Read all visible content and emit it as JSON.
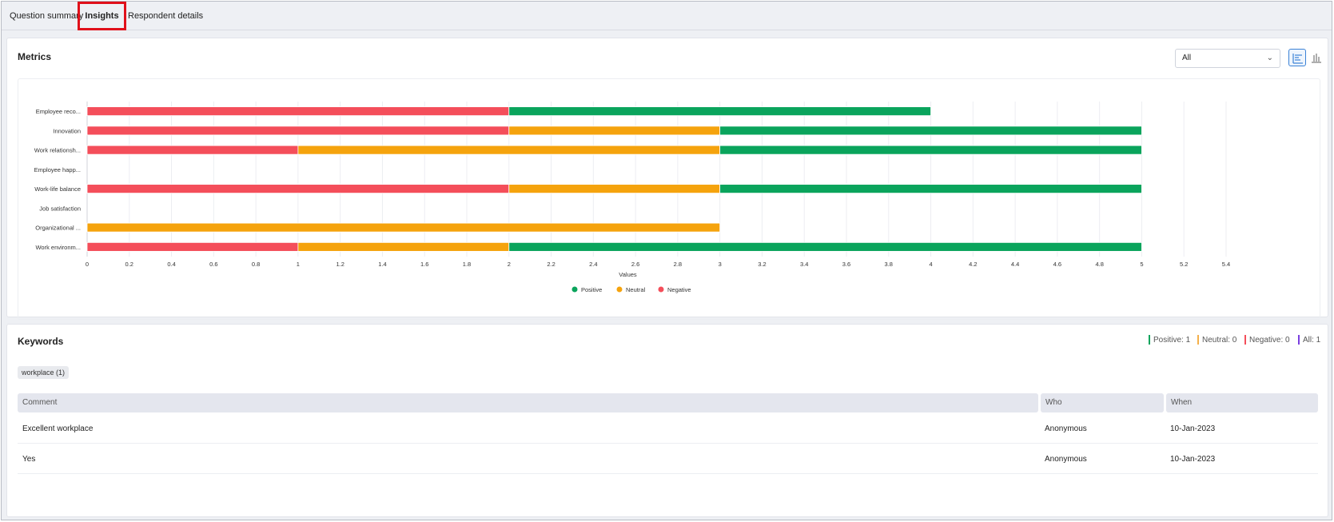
{
  "tabs": [
    {
      "label": "Question summary"
    },
    {
      "label": "Insights"
    },
    {
      "label": "Respondent details"
    }
  ],
  "metrics": {
    "title": "Metrics",
    "filter_value": "All",
    "view_icons": [
      "horizontal-bar-chart-icon",
      "vertical-bar-chart-icon"
    ]
  },
  "chart_data": {
    "type": "bar",
    "orientation": "horizontal",
    "stacked": true,
    "categories": [
      "Employee reco...",
      "Innovation",
      "Work relationsh...",
      "Employee happ...",
      "Work-life balance",
      "Job satisfaction",
      "Organizational ...",
      "Work environm..."
    ],
    "series": [
      {
        "name": "Negative",
        "color": "#f44e5a",
        "values": [
          2,
          2,
          1,
          0,
          2,
          0,
          0,
          1
        ]
      },
      {
        "name": "Neutral",
        "color": "#f5a30d",
        "values": [
          0,
          1,
          2,
          0,
          1,
          0,
          3,
          1
        ]
      },
      {
        "name": "Positive",
        "color": "#0aa45c",
        "values": [
          2,
          2,
          2,
          0,
          2,
          0,
          0,
          3
        ]
      }
    ],
    "legend": [
      "Positive",
      "Neutral",
      "Negative"
    ],
    "legend_colors": [
      "#0aa45c",
      "#f5a30d",
      "#f44e5a"
    ],
    "xlabel": "Values",
    "xlim": [
      0,
      5.4
    ],
    "xticks": [
      "0",
      "0.2",
      "0.4",
      "0.6",
      "0.8",
      "1",
      "1.2",
      "1.4",
      "1.6",
      "1.8",
      "2",
      "2.2",
      "2.4",
      "2.6",
      "2.8",
      "3",
      "3.2",
      "3.4",
      "3.6",
      "3.8",
      "4",
      "4.2",
      "4.4",
      "4.6",
      "4.8",
      "5",
      "5.2",
      "5.4"
    ],
    "grid": true,
    "legend_position": "bottom"
  },
  "keywords": {
    "title": "Keywords",
    "stats": [
      {
        "label": "Positive: 1",
        "color": "#0aa45c"
      },
      {
        "label": "Neutral: 0",
        "color": "#f5b04a"
      },
      {
        "label": "Negative: 0",
        "color": "#f44e5a"
      },
      {
        "label": "All: 1",
        "color": "#7a3fe0"
      }
    ],
    "chip": "workplace (1)",
    "table": {
      "headers": [
        "Comment",
        "Who",
        "When"
      ],
      "rows": [
        [
          "Excellent workplace",
          "Anonymous",
          "10-Jan-2023"
        ],
        [
          "Yes",
          "Anonymous",
          "10-Jan-2023"
        ]
      ]
    }
  }
}
